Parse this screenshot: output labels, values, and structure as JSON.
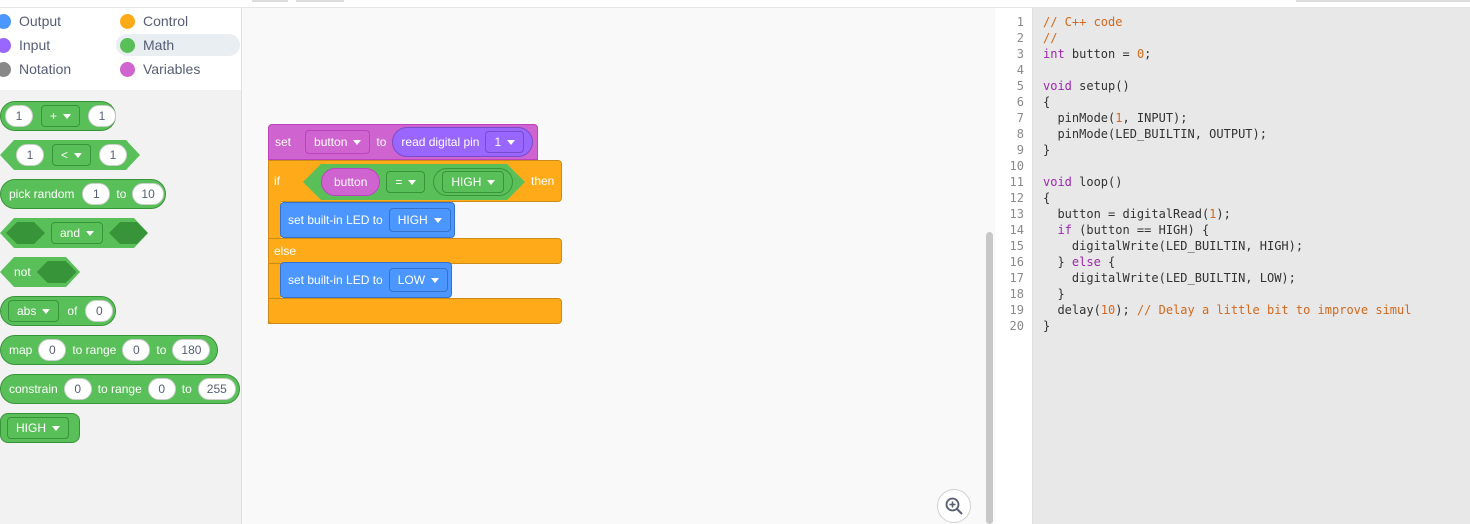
{
  "categories": [
    {
      "label": "Output",
      "color": "#4c97ff"
    },
    {
      "label": "Control",
      "color": "#ffab19"
    },
    {
      "label": "Input",
      "color": "#9966ff"
    },
    {
      "label": "Math",
      "color": "#59c059"
    },
    {
      "label": "Notation",
      "color": "#888888"
    },
    {
      "label": "Variables",
      "color": "#cf63cf"
    }
  ],
  "palette_blocks": {
    "add": {
      "left": "1",
      "op": "+",
      "right": "1"
    },
    "compare": {
      "left": "1",
      "op": "<",
      "right": "1"
    },
    "random": {
      "label": "pick random",
      "from": "1",
      "to_label": "to",
      "to": "10"
    },
    "and": {
      "op": "and"
    },
    "not": {
      "label": "not"
    },
    "abs": {
      "op": "abs",
      "of_label": "of",
      "value": "0"
    },
    "map": {
      "label": "map",
      "value": "0",
      "range_label": "to range",
      "from": "0",
      "to_label": "to",
      "to": "180"
    },
    "constrain": {
      "label": "constrain",
      "value": "0",
      "range_label": "to range",
      "from": "0",
      "to_label": "to",
      "to": "255"
    },
    "high": {
      "value": "HIGH"
    }
  },
  "workspace": {
    "set_label": "set",
    "var": "button",
    "to_label": "to",
    "read_label": "read digital pin",
    "pin": "1",
    "if_label": "if",
    "cond_var": "button",
    "cond_op": "=",
    "cond_value": "HIGH",
    "then_label": "then",
    "led1_label": "set built-in LED to",
    "led1_value": "HIGH",
    "else_label": "else",
    "led2_label": "set built-in LED to",
    "led2_value": "LOW"
  },
  "code_lines": [
    {
      "n": "1",
      "t": "// C++ code",
      "c": "cm"
    },
    {
      "n": "2",
      "t": "//",
      "c": "cm"
    },
    {
      "n": "3",
      "t": "int button = 0;",
      "c": ""
    },
    {
      "n": "4",
      "t": "",
      "c": ""
    },
    {
      "n": "5",
      "t": "void setup()",
      "c": ""
    },
    {
      "n": "6",
      "t": "{",
      "c": ""
    },
    {
      "n": "7",
      "t": "  pinMode(1, INPUT);",
      "c": ""
    },
    {
      "n": "8",
      "t": "  pinMode(LED_BUILTIN, OUTPUT);",
      "c": ""
    },
    {
      "n": "9",
      "t": "}",
      "c": ""
    },
    {
      "n": "10",
      "t": "",
      "c": ""
    },
    {
      "n": "11",
      "t": "void loop()",
      "c": ""
    },
    {
      "n": "12",
      "t": "{",
      "c": ""
    },
    {
      "n": "13",
      "t": "  button = digitalRead(1);",
      "c": ""
    },
    {
      "n": "14",
      "t": "  if (button == HIGH) {",
      "c": ""
    },
    {
      "n": "15",
      "t": "    digitalWrite(LED_BUILTIN, HIGH);",
      "c": ""
    },
    {
      "n": "16",
      "t": "  } else {",
      "c": ""
    },
    {
      "n": "17",
      "t": "    digitalWrite(LED_BUILTIN, LOW);",
      "c": ""
    },
    {
      "n": "18",
      "t": "  }",
      "c": ""
    },
    {
      "n": "19",
      "t": "  delay(10); // Delay a little bit to improve simul",
      "c": ""
    },
    {
      "n": "20",
      "t": "}",
      "c": ""
    }
  ]
}
